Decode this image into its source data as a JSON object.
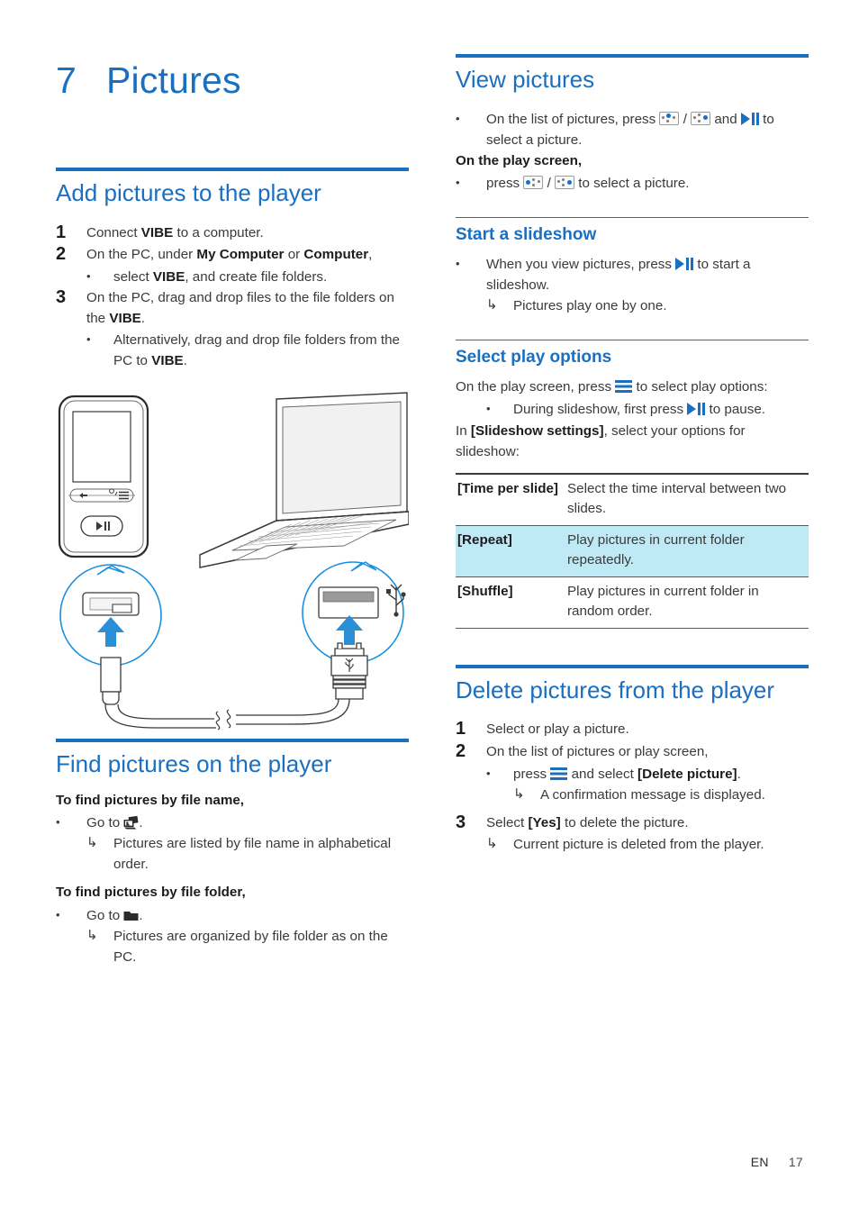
{
  "chapter": {
    "number": "7",
    "title": "Pictures"
  },
  "left": {
    "section_add": {
      "heading": "Add pictures to the player",
      "steps": [
        {
          "num": "1",
          "text_parts": [
            {
              "t": "Connect ",
              "b": false
            },
            {
              "t": "VIBE",
              "b": true
            },
            {
              "t": " to a computer.",
              "b": false
            }
          ]
        },
        {
          "num": "2",
          "text_parts": [
            {
              "t": "On the PC, under ",
              "b": false
            },
            {
              "t": "My Computer",
              "b": true
            },
            {
              "t": " or ",
              "b": false
            },
            {
              "t": "Computer",
              "b": true
            },
            {
              "t": ",",
              "b": false
            }
          ]
        },
        {
          "num": "3",
          "text_parts": [
            {
              "t": "On the PC, drag and drop files to the file folders on the ",
              "b": false
            },
            {
              "t": "VIBE",
              "b": true
            },
            {
              "t": ".",
              "b": false
            }
          ]
        }
      ],
      "bullet_step2": [
        {
          "t": "select ",
          "b": false
        },
        {
          "t": "VIBE",
          "b": true
        },
        {
          "t": ", and create file folders.",
          "b": false
        }
      ],
      "bullet_step3": [
        {
          "t": "Alternatively, drag and drop file folders from the PC to ",
          "b": false
        },
        {
          "t": "VIBE",
          "b": true
        },
        {
          "t": ".",
          "b": false
        }
      ],
      "bullet_marker": "•"
    },
    "section_find": {
      "heading": "Find pictures on the player",
      "sub1": "To find pictures by file name,",
      "sub1_bullet_prefix": "Go to ",
      "sub1_bullet_icon": "photos-icon",
      "sub1_bullet_suffix": ".",
      "sub1_result": "Pictures are listed by file name in alphabetical order.",
      "sub2": "To find pictures by file folder,",
      "sub2_bullet_prefix": "Go to ",
      "sub2_bullet_icon": "folder-icon",
      "sub2_bullet_suffix": ".",
      "sub2_result": "Pictures are organized by file folder as on the PC."
    },
    "figure": {
      "name": "usb-connection-diagram",
      "caption": "",
      "elements": [
        "mp3-player-device",
        "laptop-computer",
        "player-usb-port-callout",
        "laptop-usb-port-callout",
        "usb-cable",
        "usb-symbol"
      ]
    }
  },
  "right": {
    "section_view": {
      "heading": "View pictures",
      "bullet1_a": "On the list of pictures, press ",
      "bullet1_sep": " / ",
      "bullet1_b": " and ",
      "bullet1_c": " to select a picture.",
      "subhead": "On the play screen,",
      "bullet2_a": "press ",
      "bullet2_sep": " / ",
      "bullet2_b": " to select a picture."
    },
    "section_slideshow": {
      "heading": "Start a slideshow",
      "bullet_a": "When you view pictures, press ",
      "bullet_b": " to start a slideshow.",
      "result": "Pictures play one by one."
    },
    "section_playopts": {
      "heading": "Select play options",
      "lead_a": "On the play screen, press ",
      "lead_b": " to select play options:",
      "bullet_a": "During slideshow, first press ",
      "bullet_b": " to pause.",
      "tail_parts": [
        {
          "t": "In ",
          "b": false
        },
        {
          "t": "[Slideshow settings]",
          "b": true
        },
        {
          "t": ", select your options for slideshow:",
          "b": false
        }
      ],
      "table": {
        "rows": [
          {
            "key": "[Time per slide]",
            "value": "Select the time interval between two slides.",
            "highlight": false
          },
          {
            "key": "[Repeat]",
            "value": "Play pictures in current folder repeatedly.",
            "highlight": true
          },
          {
            "key": "[Shuffle]",
            "value": "Play pictures in current folder in random order.",
            "highlight": false
          }
        ]
      }
    },
    "section_delete": {
      "heading": "Delete pictures from the player",
      "steps": [
        {
          "num": "1",
          "text": "Select or play a picture."
        },
        {
          "num": "2",
          "text": "On the list of pictures or play screen,"
        },
        {
          "num": "3",
          "parts": [
            {
              "t": "Select ",
              "b": false
            },
            {
              "t": "[Yes]",
              "b": true
            },
            {
              "t": " to delete the picture.",
              "b": false
            }
          ]
        }
      ],
      "step2_bullet_a": "press ",
      "step2_bullet_parts": [
        {
          "t": " and select ",
          "b": false
        },
        {
          "t": "[Delete picture]",
          "b": true
        },
        {
          "t": ".",
          "b": false
        }
      ],
      "step2_result": "A confirmation message is displayed.",
      "step3_result": "Current picture is deleted from the player."
    }
  },
  "footer": {
    "language": "EN",
    "page_number": "17"
  },
  "colors": {
    "accent_blue": "#1a6fc0",
    "highlight_row": "#bfe9f5",
    "body_text": "#3a3a3a",
    "bold_text": "#1c1c1c"
  },
  "icons": {
    "play_pause": "play-pause-icon",
    "options_menu": "options-menu-icon",
    "nav_prev": "nav-prev-icon",
    "nav_next": "nav-next-icon",
    "photos": "photos-icon",
    "folder": "folder-icon"
  }
}
